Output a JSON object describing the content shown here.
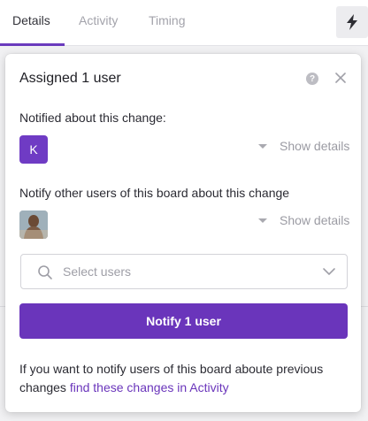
{
  "tabs": [
    {
      "label": "Details"
    },
    {
      "label": "Activity"
    },
    {
      "label": "Timing"
    }
  ],
  "toolbar": {
    "action_icon": "lightning-bolt-icon"
  },
  "popup": {
    "title": "Assigned 1 user",
    "notified_label": "Notified about this change:",
    "notified_user_initial": "K",
    "show_details": "Show details",
    "notify_other_label": "Notify other users of this board about this change",
    "select_placeholder": "Select users",
    "notify_button": "Notify 1 user",
    "footer_text": "If you want to notify users of this board aboute previous changes ",
    "footer_link": "find these changes in Activity"
  },
  "colors": {
    "accent": "#6a35bb",
    "avatar": "#6f3bc4"
  }
}
